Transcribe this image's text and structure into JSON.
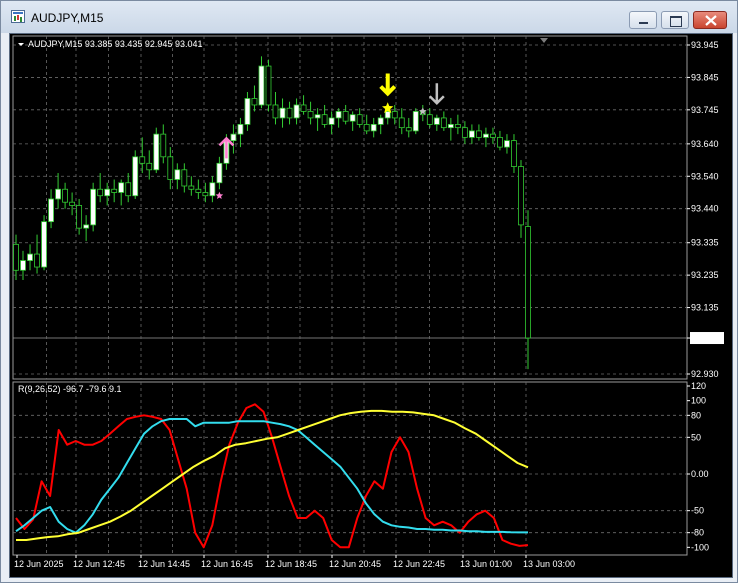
{
  "window": {
    "title": "AUDJPY,M15"
  },
  "price_chart": {
    "header": "AUDJPY,M15  93.385 93.435 92.945 93.041",
    "price_axis": [
      "93.945",
      "93.845",
      "93.745",
      "93.640",
      "93.540",
      "93.440",
      "93.335",
      "93.235",
      "93.135",
      "93.041",
      "92.930"
    ],
    "current_price": "93.041",
    "time_axis": [
      "12 Jun 2025",
      "12 Jun 12:45",
      "12 Jun 14:45",
      "12 Jun 16:45",
      "12 Jun 18:45",
      "12 Jun 20:45",
      "12 Jun 22:45",
      "13 Jun 01:00",
      "13 Jun 03:00"
    ]
  },
  "indicator": {
    "header": "R(9,26,52) -96.7 -79.6 9.1",
    "levels": [
      "120",
      "100",
      "80",
      "50",
      "0.00",
      "-50",
      "-80",
      "-100"
    ]
  },
  "colors": {
    "background": "#000000",
    "grid": "#6b6b6b",
    "candle_up_body": "#ffffff",
    "candle_down_body": "#33cc33",
    "wick": "#33cc33",
    "fast_line": "#ff0000",
    "mid_line": "#33ddee",
    "slow_line": "#ffff33",
    "arrow_up": "#ff7fd0",
    "arrow_down_yellow": "#ffff00",
    "arrow_down_gray": "#c0c0c0"
  },
  "chart_data": [
    {
      "type": "candlestick",
      "symbol": "AUDJPY",
      "timeframe": "M15",
      "ylim": [
        92.93,
        93.945
      ],
      "last": {
        "open": 93.385,
        "high": 93.435,
        "low": 92.945,
        "close": 93.041
      },
      "candles": [
        {
          "o": 93.33,
          "h": 93.36,
          "l": 93.22,
          "c": 93.25
        },
        {
          "o": 93.25,
          "h": 93.31,
          "l": 93.22,
          "c": 93.28
        },
        {
          "o": 93.28,
          "h": 93.33,
          "l": 93.25,
          "c": 93.3
        },
        {
          "o": 93.3,
          "h": 93.36,
          "l": 93.24,
          "c": 93.26
        },
        {
          "o": 93.26,
          "h": 93.42,
          "l": 93.25,
          "c": 93.4
        },
        {
          "o": 93.4,
          "h": 93.5,
          "l": 93.38,
          "c": 93.47
        },
        {
          "o": 93.47,
          "h": 93.55,
          "l": 93.44,
          "c": 93.5
        },
        {
          "o": 93.5,
          "h": 93.52,
          "l": 93.44,
          "c": 93.46
        },
        {
          "o": 93.46,
          "h": 93.49,
          "l": 93.42,
          "c": 93.45
        },
        {
          "o": 93.45,
          "h": 93.47,
          "l": 93.36,
          "c": 93.38
        },
        {
          "o": 93.38,
          "h": 93.42,
          "l": 93.34,
          "c": 93.39
        },
        {
          "o": 93.39,
          "h": 93.52,
          "l": 93.37,
          "c": 93.5
        },
        {
          "o": 93.5,
          "h": 93.55,
          "l": 93.46,
          "c": 93.48
        },
        {
          "o": 93.48,
          "h": 93.52,
          "l": 93.45,
          "c": 93.5
        },
        {
          "o": 93.5,
          "h": 93.53,
          "l": 93.46,
          "c": 93.49
        },
        {
          "o": 93.49,
          "h": 93.53,
          "l": 93.45,
          "c": 93.52
        },
        {
          "o": 93.52,
          "h": 93.55,
          "l": 93.46,
          "c": 93.48
        },
        {
          "o": 93.48,
          "h": 93.62,
          "l": 93.47,
          "c": 93.6
        },
        {
          "o": 93.6,
          "h": 93.66,
          "l": 93.55,
          "c": 93.58
        },
        {
          "o": 93.58,
          "h": 93.62,
          "l": 93.53,
          "c": 93.56
        },
        {
          "o": 93.56,
          "h": 93.69,
          "l": 93.55,
          "c": 93.67
        },
        {
          "o": 93.67,
          "h": 93.7,
          "l": 93.58,
          "c": 93.6
        },
        {
          "o": 93.6,
          "h": 93.63,
          "l": 93.5,
          "c": 93.53
        },
        {
          "o": 93.53,
          "h": 93.58,
          "l": 93.5,
          "c": 93.56
        },
        {
          "o": 93.56,
          "h": 93.58,
          "l": 93.49,
          "c": 93.51
        },
        {
          "o": 93.51,
          "h": 93.54,
          "l": 93.48,
          "c": 93.5
        },
        {
          "o": 93.5,
          "h": 93.53,
          "l": 93.47,
          "c": 93.49
        },
        {
          "o": 93.49,
          "h": 93.52,
          "l": 93.46,
          "c": 93.48
        },
        {
          "o": 93.48,
          "h": 93.54,
          "l": 93.46,
          "c": 93.52
        },
        {
          "o": 93.52,
          "h": 93.6,
          "l": 93.5,
          "c": 93.58
        },
        {
          "o": 93.58,
          "h": 93.67,
          "l": 93.56,
          "c": 93.65
        },
        {
          "o": 93.65,
          "h": 93.7,
          "l": 93.61,
          "c": 93.67
        },
        {
          "o": 93.67,
          "h": 93.72,
          "l": 93.63,
          "c": 93.7
        },
        {
          "o": 93.7,
          "h": 93.8,
          "l": 93.68,
          "c": 93.78
        },
        {
          "o": 93.78,
          "h": 93.82,
          "l": 93.74,
          "c": 93.76
        },
        {
          "o": 93.76,
          "h": 93.91,
          "l": 93.75,
          "c": 93.88
        },
        {
          "o": 93.88,
          "h": 93.9,
          "l": 93.74,
          "c": 93.76
        },
        {
          "o": 93.76,
          "h": 93.8,
          "l": 93.7,
          "c": 93.72
        },
        {
          "o": 93.72,
          "h": 93.78,
          "l": 93.69,
          "c": 93.75
        },
        {
          "o": 93.75,
          "h": 93.77,
          "l": 93.7,
          "c": 93.72
        },
        {
          "o": 93.72,
          "h": 93.78,
          "l": 93.7,
          "c": 93.76
        },
        {
          "o": 93.76,
          "h": 93.79,
          "l": 93.73,
          "c": 93.74
        },
        {
          "o": 93.74,
          "h": 93.77,
          "l": 93.7,
          "c": 93.72
        },
        {
          "o": 93.72,
          "h": 93.75,
          "l": 93.68,
          "c": 93.73
        },
        {
          "o": 93.73,
          "h": 93.76,
          "l": 93.69,
          "c": 93.7
        },
        {
          "o": 93.7,
          "h": 93.74,
          "l": 93.67,
          "c": 93.72
        },
        {
          "o": 93.72,
          "h": 93.75,
          "l": 93.69,
          "c": 93.74
        },
        {
          "o": 93.74,
          "h": 93.76,
          "l": 93.7,
          "c": 93.71
        },
        {
          "o": 93.71,
          "h": 93.74,
          "l": 93.68,
          "c": 93.73
        },
        {
          "o": 93.73,
          "h": 93.75,
          "l": 93.69,
          "c": 93.7
        },
        {
          "o": 93.7,
          "h": 93.73,
          "l": 93.67,
          "c": 93.68
        },
        {
          "o": 93.68,
          "h": 93.72,
          "l": 93.66,
          "c": 93.7
        },
        {
          "o": 93.7,
          "h": 93.73,
          "l": 93.67,
          "c": 93.72
        },
        {
          "o": 93.72,
          "h": 93.76,
          "l": 93.7,
          "c": 93.74
        },
        {
          "o": 93.74,
          "h": 93.76,
          "l": 93.7,
          "c": 93.72
        },
        {
          "o": 93.72,
          "h": 93.75,
          "l": 93.67,
          "c": 93.69
        },
        {
          "o": 93.69,
          "h": 93.72,
          "l": 93.66,
          "c": 93.68
        },
        {
          "o": 93.68,
          "h": 93.75,
          "l": 93.67,
          "c": 93.74
        },
        {
          "o": 93.74,
          "h": 93.76,
          "l": 93.71,
          "c": 93.73
        },
        {
          "o": 93.73,
          "h": 93.75,
          "l": 93.69,
          "c": 93.7
        },
        {
          "o": 93.7,
          "h": 93.73,
          "l": 93.68,
          "c": 93.72
        },
        {
          "o": 93.72,
          "h": 93.74,
          "l": 93.68,
          "c": 93.69
        },
        {
          "o": 93.69,
          "h": 93.72,
          "l": 93.65,
          "c": 93.7
        },
        {
          "o": 93.7,
          "h": 93.73,
          "l": 93.67,
          "c": 93.69
        },
        {
          "o": 93.69,
          "h": 93.71,
          "l": 93.64,
          "c": 93.66
        },
        {
          "o": 93.66,
          "h": 93.7,
          "l": 93.64,
          "c": 93.68
        },
        {
          "o": 93.68,
          "h": 93.7,
          "l": 93.65,
          "c": 93.66
        },
        {
          "o": 93.66,
          "h": 93.69,
          "l": 93.63,
          "c": 93.67
        },
        {
          "o": 93.67,
          "h": 93.69,
          "l": 93.64,
          "c": 93.66
        },
        {
          "o": 93.66,
          "h": 93.68,
          "l": 93.62,
          "c": 93.63
        },
        {
          "o": 93.63,
          "h": 93.67,
          "l": 93.61,
          "c": 93.65
        },
        {
          "o": 93.65,
          "h": 93.67,
          "l": 93.55,
          "c": 93.57
        },
        {
          "o": 93.57,
          "h": 93.59,
          "l": 93.35,
          "c": 93.39
        },
        {
          "o": 93.385,
          "h": 93.435,
          "l": 92.945,
          "c": 93.041
        }
      ],
      "markers": [
        {
          "type": "arrow-up",
          "color": "pink",
          "candle": 30,
          "price": 93.62
        },
        {
          "type": "star",
          "color": "pink",
          "candle": 29,
          "price": 93.48
        },
        {
          "type": "arrow-down",
          "color": "yellow",
          "candle": 53,
          "price": 93.82
        },
        {
          "type": "star",
          "color": "yellow",
          "candle": 53,
          "price": 93.75
        },
        {
          "type": "arrow-down",
          "color": "gray",
          "candle": 60,
          "price": 93.79
        },
        {
          "type": "star",
          "color": "gray",
          "candle": 58,
          "price": 93.74
        }
      ]
    },
    {
      "type": "line",
      "title": "R(9,26,52) -96.7 -79.6 9.1",
      "ylim": [
        -105,
        120
      ],
      "series": [
        {
          "color": "red",
          "values": [
            -60,
            -75,
            -62,
            -10,
            -30,
            60,
            40,
            45,
            40,
            40,
            45,
            55,
            65,
            75,
            78,
            80,
            78,
            75,
            60,
            20,
            -20,
            -80,
            -100,
            -70,
            -10,
            40,
            70,
            90,
            95,
            85,
            50,
            10,
            -30,
            -60,
            -60,
            -50,
            -60,
            -90,
            -100,
            -100,
            -60,
            -30,
            -10,
            -20,
            30,
            50,
            30,
            -20,
            -60,
            -70,
            -65,
            -70,
            -80,
            -65,
            -55,
            -50,
            -60,
            -90,
            -95,
            -98,
            -97
          ]
        },
        {
          "color": "cyan",
          "values": [
            -78,
            -70,
            -60,
            -50,
            -45,
            -65,
            -75,
            -80,
            -70,
            -55,
            -35,
            -20,
            -5,
            15,
            35,
            55,
            65,
            72,
            75,
            75,
            75,
            65,
            70,
            70,
            70,
            70,
            72,
            72,
            72,
            72,
            70,
            68,
            65,
            60,
            50,
            40,
            30,
            20,
            10,
            -5,
            -20,
            -40,
            -55,
            -65,
            -70,
            -72,
            -73,
            -75,
            -75,
            -76,
            -76,
            -77,
            -77,
            -78,
            -78,
            -79,
            -79,
            -79,
            -79.5,
            -79.6,
            -79.6
          ]
        },
        {
          "color": "yellow",
          "values": [
            -90,
            -90,
            -88,
            -86,
            -85,
            -82,
            -80,
            -75,
            -70,
            -65,
            -58,
            -50,
            -40,
            -30,
            -20,
            -10,
            0,
            10,
            18,
            25,
            35,
            40,
            42,
            45,
            48,
            50,
            55,
            60,
            65,
            70,
            75,
            80,
            83,
            85,
            86,
            86,
            85,
            85,
            84,
            82,
            80,
            75,
            70,
            62,
            55,
            45,
            35,
            25,
            15,
            9.1
          ]
        }
      ]
    }
  ]
}
